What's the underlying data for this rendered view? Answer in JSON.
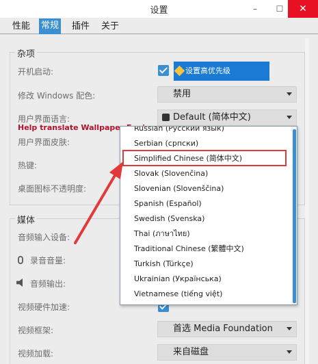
{
  "window": {
    "title": "设置"
  },
  "titlebar": {
    "minimize": "–",
    "maximize": "☐",
    "close": "✕"
  },
  "tabs": [
    {
      "label": "性能",
      "active": false
    },
    {
      "label": "常规",
      "active": true
    },
    {
      "label": "插件",
      "active": false
    },
    {
      "label": "关于",
      "active": false
    }
  ],
  "general": {
    "title": "杂项",
    "startup_label": "开机启动:",
    "startup_button": "设置高优先级",
    "windows_color_label": "修改 Windows 配色:",
    "windows_color_value": "禁用",
    "ui_language_label": "用户界面语言:",
    "ui_language_value": "Default (简体中文)",
    "help_translate": "Help translate Wallpaper Engine",
    "ui_skin_label": "用户界面皮肤:",
    "hotkey_label": "热键:",
    "desktop_icon_label": "桌面图标不透明度:"
  },
  "media": {
    "title": "媒体",
    "audio_input_label": "音频输入设备:",
    "record_volume_label": "录音音量:",
    "audio_output_label": "音频输出:",
    "hw_accel_label": "视频硬件加速:",
    "video_framework_label": "视频框架:",
    "video_framework_value": "首选 Media Foundation",
    "video_loading_label": "视频加载:",
    "video_loading_value": "来自磁盘"
  },
  "language_options": [
    "Russian (Русский язык)",
    "Serbian (српски)",
    "Simplified Chinese (简体中文)",
    "Slovak (Slovenčina)",
    "Slovenian (Slovenščina)",
    "Spanish (Español)",
    "Swedish (Svenska)",
    "Thai (ภาษาไทย)",
    "Traditional Chinese (繁體中文)",
    "Turkish (Türkçe)",
    "Ukrainian (Українська)",
    "Vietnamese (tiếng việt)"
  ],
  "colors": {
    "accent": "#3a8fd1",
    "close": "#e81123",
    "annotation": "#e03a3a",
    "help_text": "#b0132b"
  }
}
